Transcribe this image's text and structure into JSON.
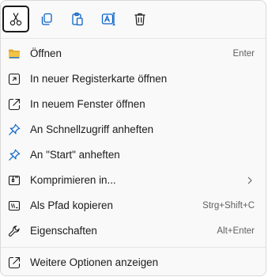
{
  "toolbar": {
    "buttons": [
      {
        "name": "cut-icon",
        "focused": true
      },
      {
        "name": "copy-icon",
        "focused": false
      },
      {
        "name": "paste-icon",
        "focused": false
      },
      {
        "name": "rename-icon",
        "focused": false
      },
      {
        "name": "delete-icon",
        "focused": false
      }
    ]
  },
  "menu": {
    "items": [
      {
        "label": "Öffnen",
        "shortcut": "Enter",
        "icon": "folder-icon"
      },
      {
        "label": "In neuer Registerkarte öffnen",
        "shortcut": "",
        "icon": "new-tab-icon"
      },
      {
        "label": "In neuem Fenster öffnen",
        "shortcut": "",
        "icon": "new-window-icon"
      },
      {
        "label": "An Schnellzugriff anheften",
        "shortcut": "",
        "icon": "pin-icon"
      },
      {
        "label": "An \"Start\" anheften",
        "shortcut": "",
        "icon": "pin-icon"
      },
      {
        "label": "Komprimieren in...",
        "shortcut": "",
        "icon": "zip-icon",
        "submenu": true
      },
      {
        "label": "Als Pfad kopieren",
        "shortcut": "Strg+Shift+C",
        "icon": "copy-path-icon"
      },
      {
        "label": "Eigenschaften",
        "shortcut": "Alt+Enter",
        "icon": "wrench-icon"
      }
    ],
    "more": {
      "label": "Weitere Optionen anzeigen",
      "shortcut": "",
      "icon": "more-options-icon"
    }
  },
  "colors": {
    "accent": "#0a63c9",
    "folder": "#f3c344"
  }
}
